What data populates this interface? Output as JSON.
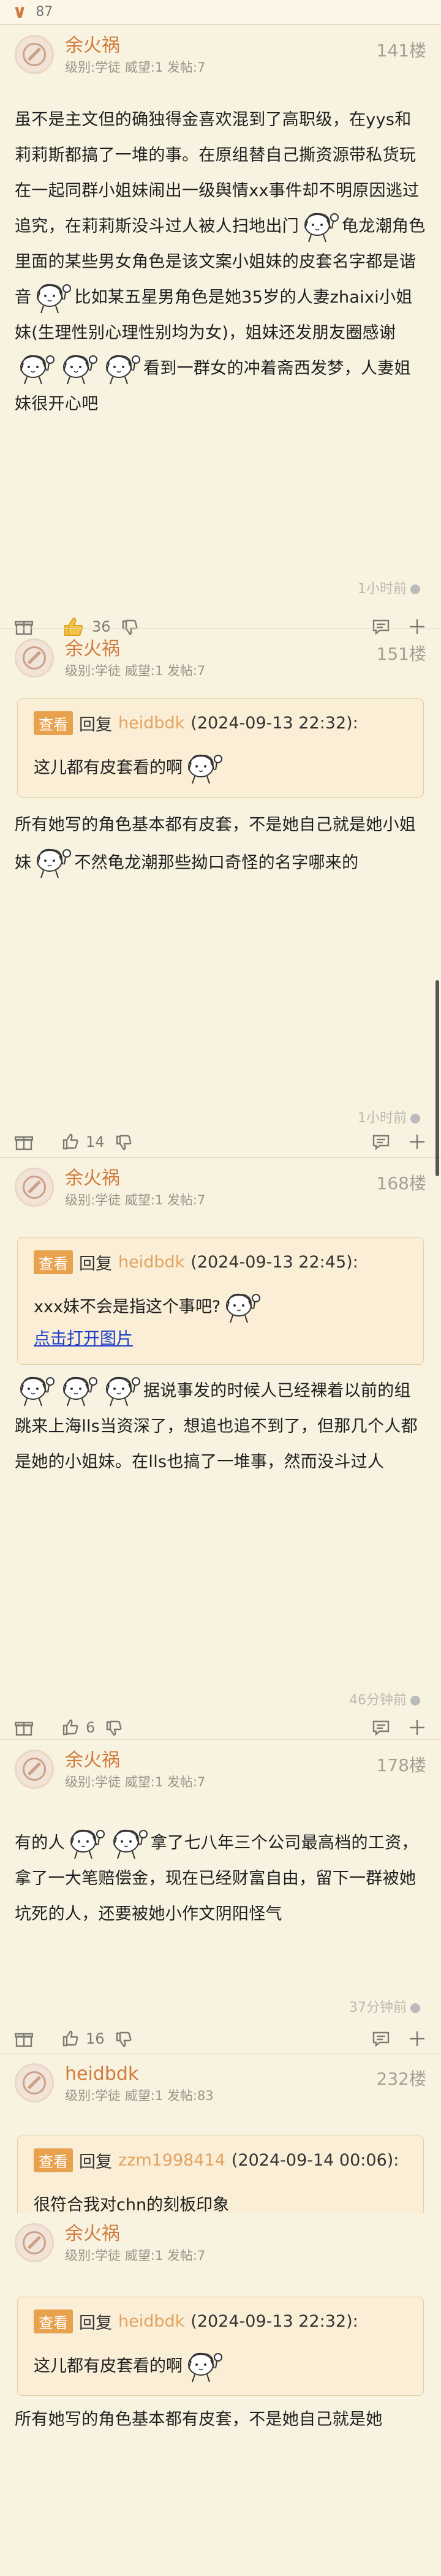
{
  "top": {
    "left_count": "87"
  },
  "posts": [
    {
      "author": "余火祸",
      "meta": "级别:学徒 威望:1 发帖:7",
      "floor": "141楼",
      "body": {
        "t1": "虽不是主文但的确独得金喜欢混到了高职级，在yys和莉莉斯都搞了一堆的事。在原组替自己撕资源带私货玩在一起同群小姐妹闹出一级舆情xx事件却不明原因逃过追究，在莉莉斯没斗过人被人扫地出门",
        "t2": "龟龙潮角色里面的某些男女角色是该文案小姐妹的皮套名字都是谐音",
        "t3": "比如某五星男角色是她35岁的人妻zhaixi小姐妹(生理性别心理性别均为女)，姐妹还发朋友圈感谢",
        "t4": "看到一群女的冲着斋西发梦，人妻姐妹很开心吧"
      },
      "time": "1小时前",
      "likes": "36"
    },
    {
      "author": "余火祸",
      "meta": "级别:学徒 威望:1 发帖:7",
      "floor": "151楼",
      "quote": {
        "tag": "查看",
        "reply": "回复",
        "user": "heidbdk",
        "time": "(2024-09-13 22:32):",
        "text": "这儿都有皮套看的啊"
      },
      "body": {
        "t1": "所有她写的角色基本都有皮套，不是她自己就是她小姐妹",
        "t2": "不然龟龙潮那些拗口奇怪的名字哪来的"
      },
      "time": "1小时前",
      "likes": "14"
    },
    {
      "author": "余火祸",
      "meta": "级别:学徒 威望:1 发帖:7",
      "floor": "168楼",
      "quote": {
        "tag": "查看",
        "reply": "回复",
        "user": "heidbdk",
        "time": "(2024-09-13 22:45):",
        "text": "xxx妹不会是指这个事吧?",
        "link": "点击打开图片"
      },
      "body": {
        "t1": "据说事发的时候人已经裸着以前的组跳来上海lls当资深了，想追也追不到了，但那几个人都是她的小姐妹。在lls也搞了一堆事，然而没斗过人"
      },
      "time": "46分钟前",
      "likes": "6"
    },
    {
      "author": "余火祸",
      "meta": "级别:学徒 威望:1 发帖:7",
      "floor": "178楼",
      "body": {
        "t1": "有的人",
        "t2": "拿了七八年三个公司最高档的工资，拿了一大笔赔偿金，现在已经财富自由，留下一群被她坑死的人，还要被她小作文阴阳怪气"
      },
      "time": "37分钟前",
      "likes": "16"
    },
    {
      "author": "heidbdk",
      "meta": "级别:学徒 威望:1 发帖:83",
      "floor": "232楼",
      "quote": {
        "tag": "查看",
        "reply": "回复",
        "user": "zzm1998414",
        "time": "(2024-09-14 00:06):",
        "text": "很符合我对chn的刻板印象"
      }
    },
    {
      "author": "余火祸",
      "meta": "级别:学徒 威望:1 发帖:7",
      "quote": {
        "tag": "查看",
        "reply": "回复",
        "user": "heidbdk",
        "time": "(2024-09-13 22:32):",
        "text": "这儿都有皮套看的啊"
      },
      "body": {
        "t1": "所有她写的角色基本都有皮套，不是她自己就是她"
      }
    }
  ],
  "colors": {
    "accent": "#d07b3c",
    "background": "#f8f3e1",
    "quote_bg": "#fbeed7",
    "chip": "#e8a24e",
    "link": "#1a3ec9"
  }
}
